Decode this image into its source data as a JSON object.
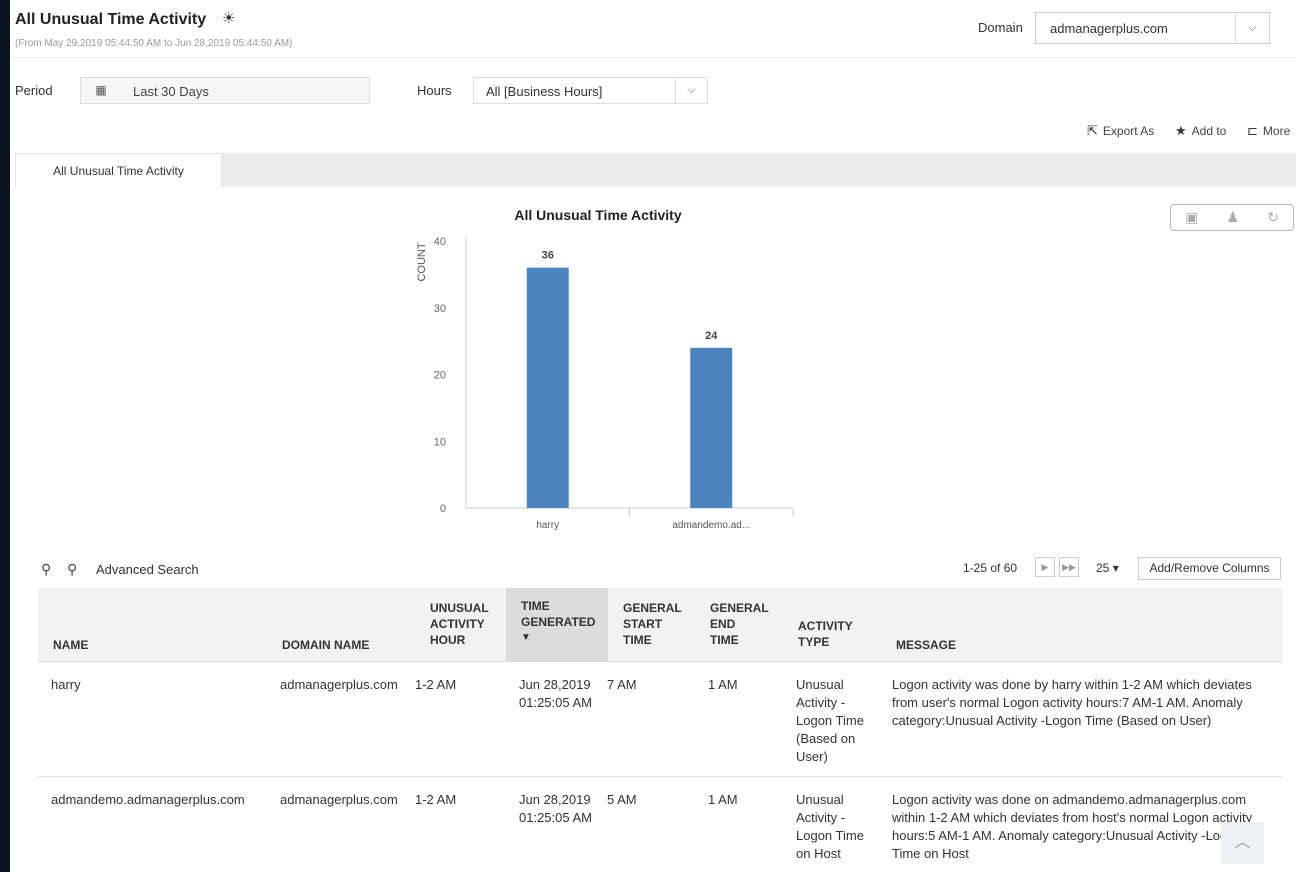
{
  "header": {
    "title": "All Unusual Time Activity",
    "date_range": "(From May 29,2019 05:44:50 AM to Jun 28,2019 05:44:50 AM)",
    "domain_label": "Domain",
    "domain_value": "admanagerplus.com"
  },
  "filters": {
    "period_label": "Period",
    "period_value": "Last 30 Days",
    "hours_label": "Hours",
    "hours_value": "All [Business Hours]"
  },
  "actions": {
    "export": "Export As",
    "add_to": "Add to",
    "more": "More"
  },
  "tabs": [
    {
      "label": "All Unusual Time Activity"
    }
  ],
  "chart_data": {
    "type": "bar",
    "title": "All Unusual Time Activity",
    "ylabel": "COUNT",
    "xlabel": "",
    "categories": [
      "harry",
      "admandemo.ad..."
    ],
    "values": [
      36,
      24
    ],
    "ylim": [
      0,
      40
    ],
    "yticks": [
      0,
      10,
      20,
      30,
      40
    ],
    "bar_color": "#4a85c0",
    "grid": false
  },
  "table": {
    "search_label": "Advanced Search",
    "pagination": "1-25 of 60",
    "page_size": "25",
    "add_remove_label": "Add/Remove Columns",
    "columns": {
      "name": "NAME",
      "domain": "DOMAIN NAME",
      "hour": [
        "UNUSUAL",
        "ACTIVITY",
        "HOUR"
      ],
      "generated": [
        "TIME",
        "GENERATED"
      ],
      "start": [
        "GENERAL",
        "START",
        "TIME"
      ],
      "end": [
        "GENERAL",
        "END",
        "TIME"
      ],
      "type": [
        "ACTIVITY",
        "TYPE"
      ],
      "message": "MESSAGE"
    },
    "rows": [
      {
        "name": "harry",
        "domain": "admanagerplus.com",
        "hour": "1-2 AM",
        "generated": [
          "Jun 28,2019",
          "01:25:05 AM"
        ],
        "start": "7 AM",
        "end": "1 AM",
        "type": [
          "Unusual",
          "Activity -",
          "Logon Time",
          "(Based on",
          "User)"
        ],
        "message": [
          "Logon activity was done by harry within 1-2 AM which deviates",
          "from user's normal Logon activity hours:7 AM-1 AM. Anomaly",
          "category:Unusual Activity -Logon Time (Based on User)"
        ]
      },
      {
        "name": "admandemo.admanagerplus.com",
        "domain": "admanagerplus.com",
        "hour": "1-2 AM",
        "generated": [
          "Jun 28,2019",
          "01:25:05 AM"
        ],
        "start": "5 AM",
        "end": "1 AM",
        "type": [
          "Unusual",
          "Activity -",
          "Logon Time",
          "on Host"
        ],
        "message": [
          "Logon activity was done on admandemo.admanagerplus.com",
          "within 1-2 AM which deviates from host's normal Logon activity",
          "hours:5 AM-1 AM. Anomaly category:Unusual Activity -Logon",
          "Time on Host"
        ]
      }
    ]
  }
}
